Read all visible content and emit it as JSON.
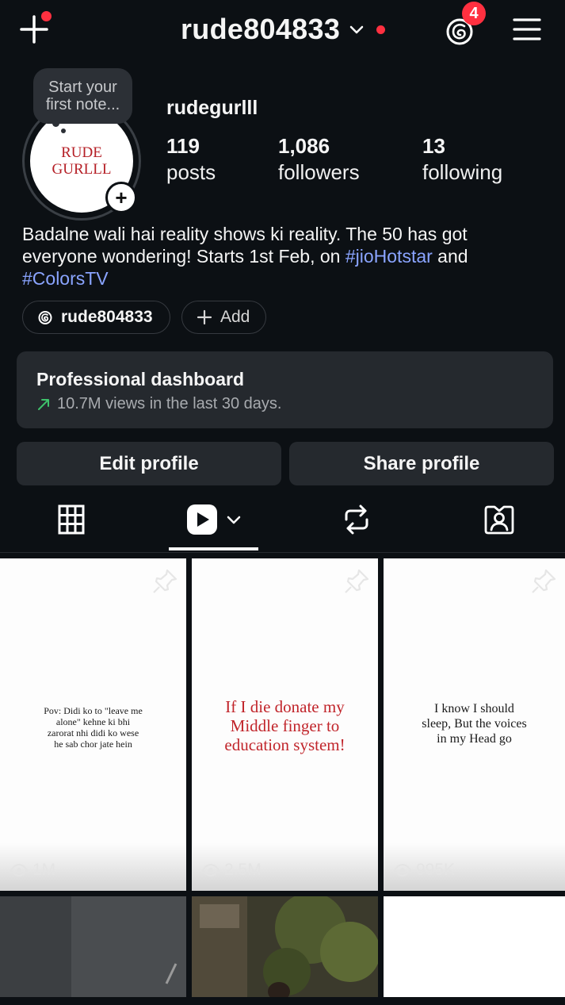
{
  "header": {
    "username": "rude804833",
    "threads_badge": "4"
  },
  "profile": {
    "note_line1": "Start your",
    "note_line2": "first note...",
    "avatar_line1": "RUDE",
    "avatar_line2": "GURLLL",
    "display_name": "rudegurlll",
    "stats": {
      "posts": {
        "value": "119",
        "label": "posts"
      },
      "followers": {
        "value": "1,086",
        "label": "followers"
      },
      "following": {
        "value": "13",
        "label": "following"
      }
    },
    "bio_text": "Badalne wali hai reality shows ki reality. The 50 has got everyone wondering! Starts 1st Feb, on ",
    "bio_tag1": "#jioHotstar",
    "bio_and": " and ",
    "bio_tag2": "#ColorsTV",
    "threads_chip": "rude804833",
    "add_chip": "Add"
  },
  "dashboard": {
    "title": "Professional dashboard",
    "subtitle": "10.7M views in the last 30 days."
  },
  "buttons": {
    "edit": "Edit profile",
    "share": "Share profile"
  },
  "tabs": [
    "grid-icon",
    "reels-icon",
    "reposts-icon",
    "tagged-icon"
  ],
  "grid": [
    {
      "text": "Pov: Didi ko to \"leave me alone\" kehne ki bhi zarorat nhi didi ko wese he sab chor jate hein",
      "views": "1M"
    },
    {
      "text": "If I die donate my Middle finger to education system!",
      "views": "2.5M"
    },
    {
      "text": "I know I should sleep, But the voices in my Head go",
      "views": "995K"
    }
  ],
  "colors": {
    "background": "#0c1014",
    "accent_red": "#ff3040",
    "hashtag": "#8aa4ff",
    "card": "#25292e"
  }
}
